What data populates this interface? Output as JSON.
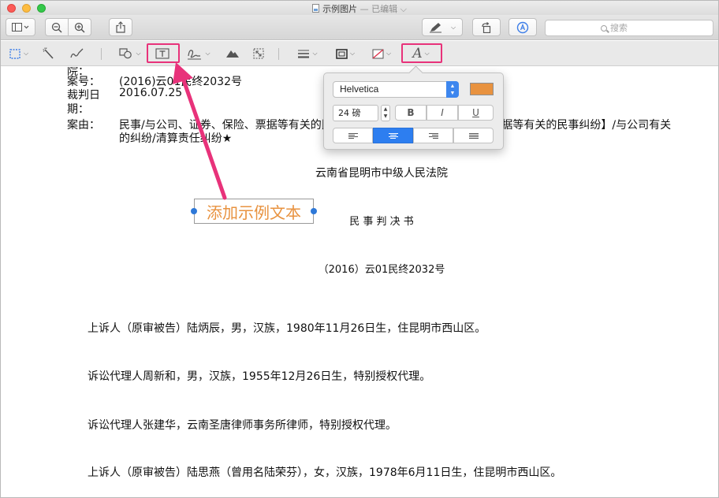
{
  "window": {
    "title": "示例图片",
    "status": "— 已编辑 ⌵"
  },
  "toolbar": {
    "search_placeholder": "搜索"
  },
  "document": {
    "partial_top": "院：",
    "meta": [
      {
        "label": "案号：",
        "value": "(2016)云01民终2032号"
      },
      {
        "label": "裁判日",
        "value": "2016.07.25"
      },
      {
        "label": "期：",
        "value": ""
      },
      {
        "label": "案由：",
        "value": "民事/与公司、证券、保险、票据等有关的民事纠纷/【与公司、证券、保险、票据等有关的民事纠纷】/与公司有关"
      }
    ],
    "meta_cont": "的纠纷/清算责任纠纷★",
    "court": "云南省昆明市中级人民法院",
    "doc_type": "民 事 判 决 书",
    "case_no": "（2016）云01民终2032号",
    "paragraphs": [
      "上诉人（原审被告）陆炳辰，男，汉族，1980年11月26日生，住昆明市西山区。",
      "诉讼代理人周新和，男，汉族，1955年12月26日生，特别授权代理。",
      "诉讼代理人张建华，云南圣唐律师事务所律师，特别授权代理。",
      "上诉人（原审被告）陆思燕（曾用名陆荣芬），女，汉族，1978年6月11日生，住昆明市西山区。"
    ]
  },
  "textbox": {
    "text": "添加示例文本",
    "color": "#e8923f"
  },
  "font_popover": {
    "font_name": "Helvetica",
    "font_size": "24 磅",
    "bold": "B",
    "italic": "I",
    "underline": "U",
    "color": "#e8923f",
    "alignment_selected": "center"
  },
  "colors": {
    "highlight": "#e8327a",
    "accent": "#2d7ef0"
  }
}
